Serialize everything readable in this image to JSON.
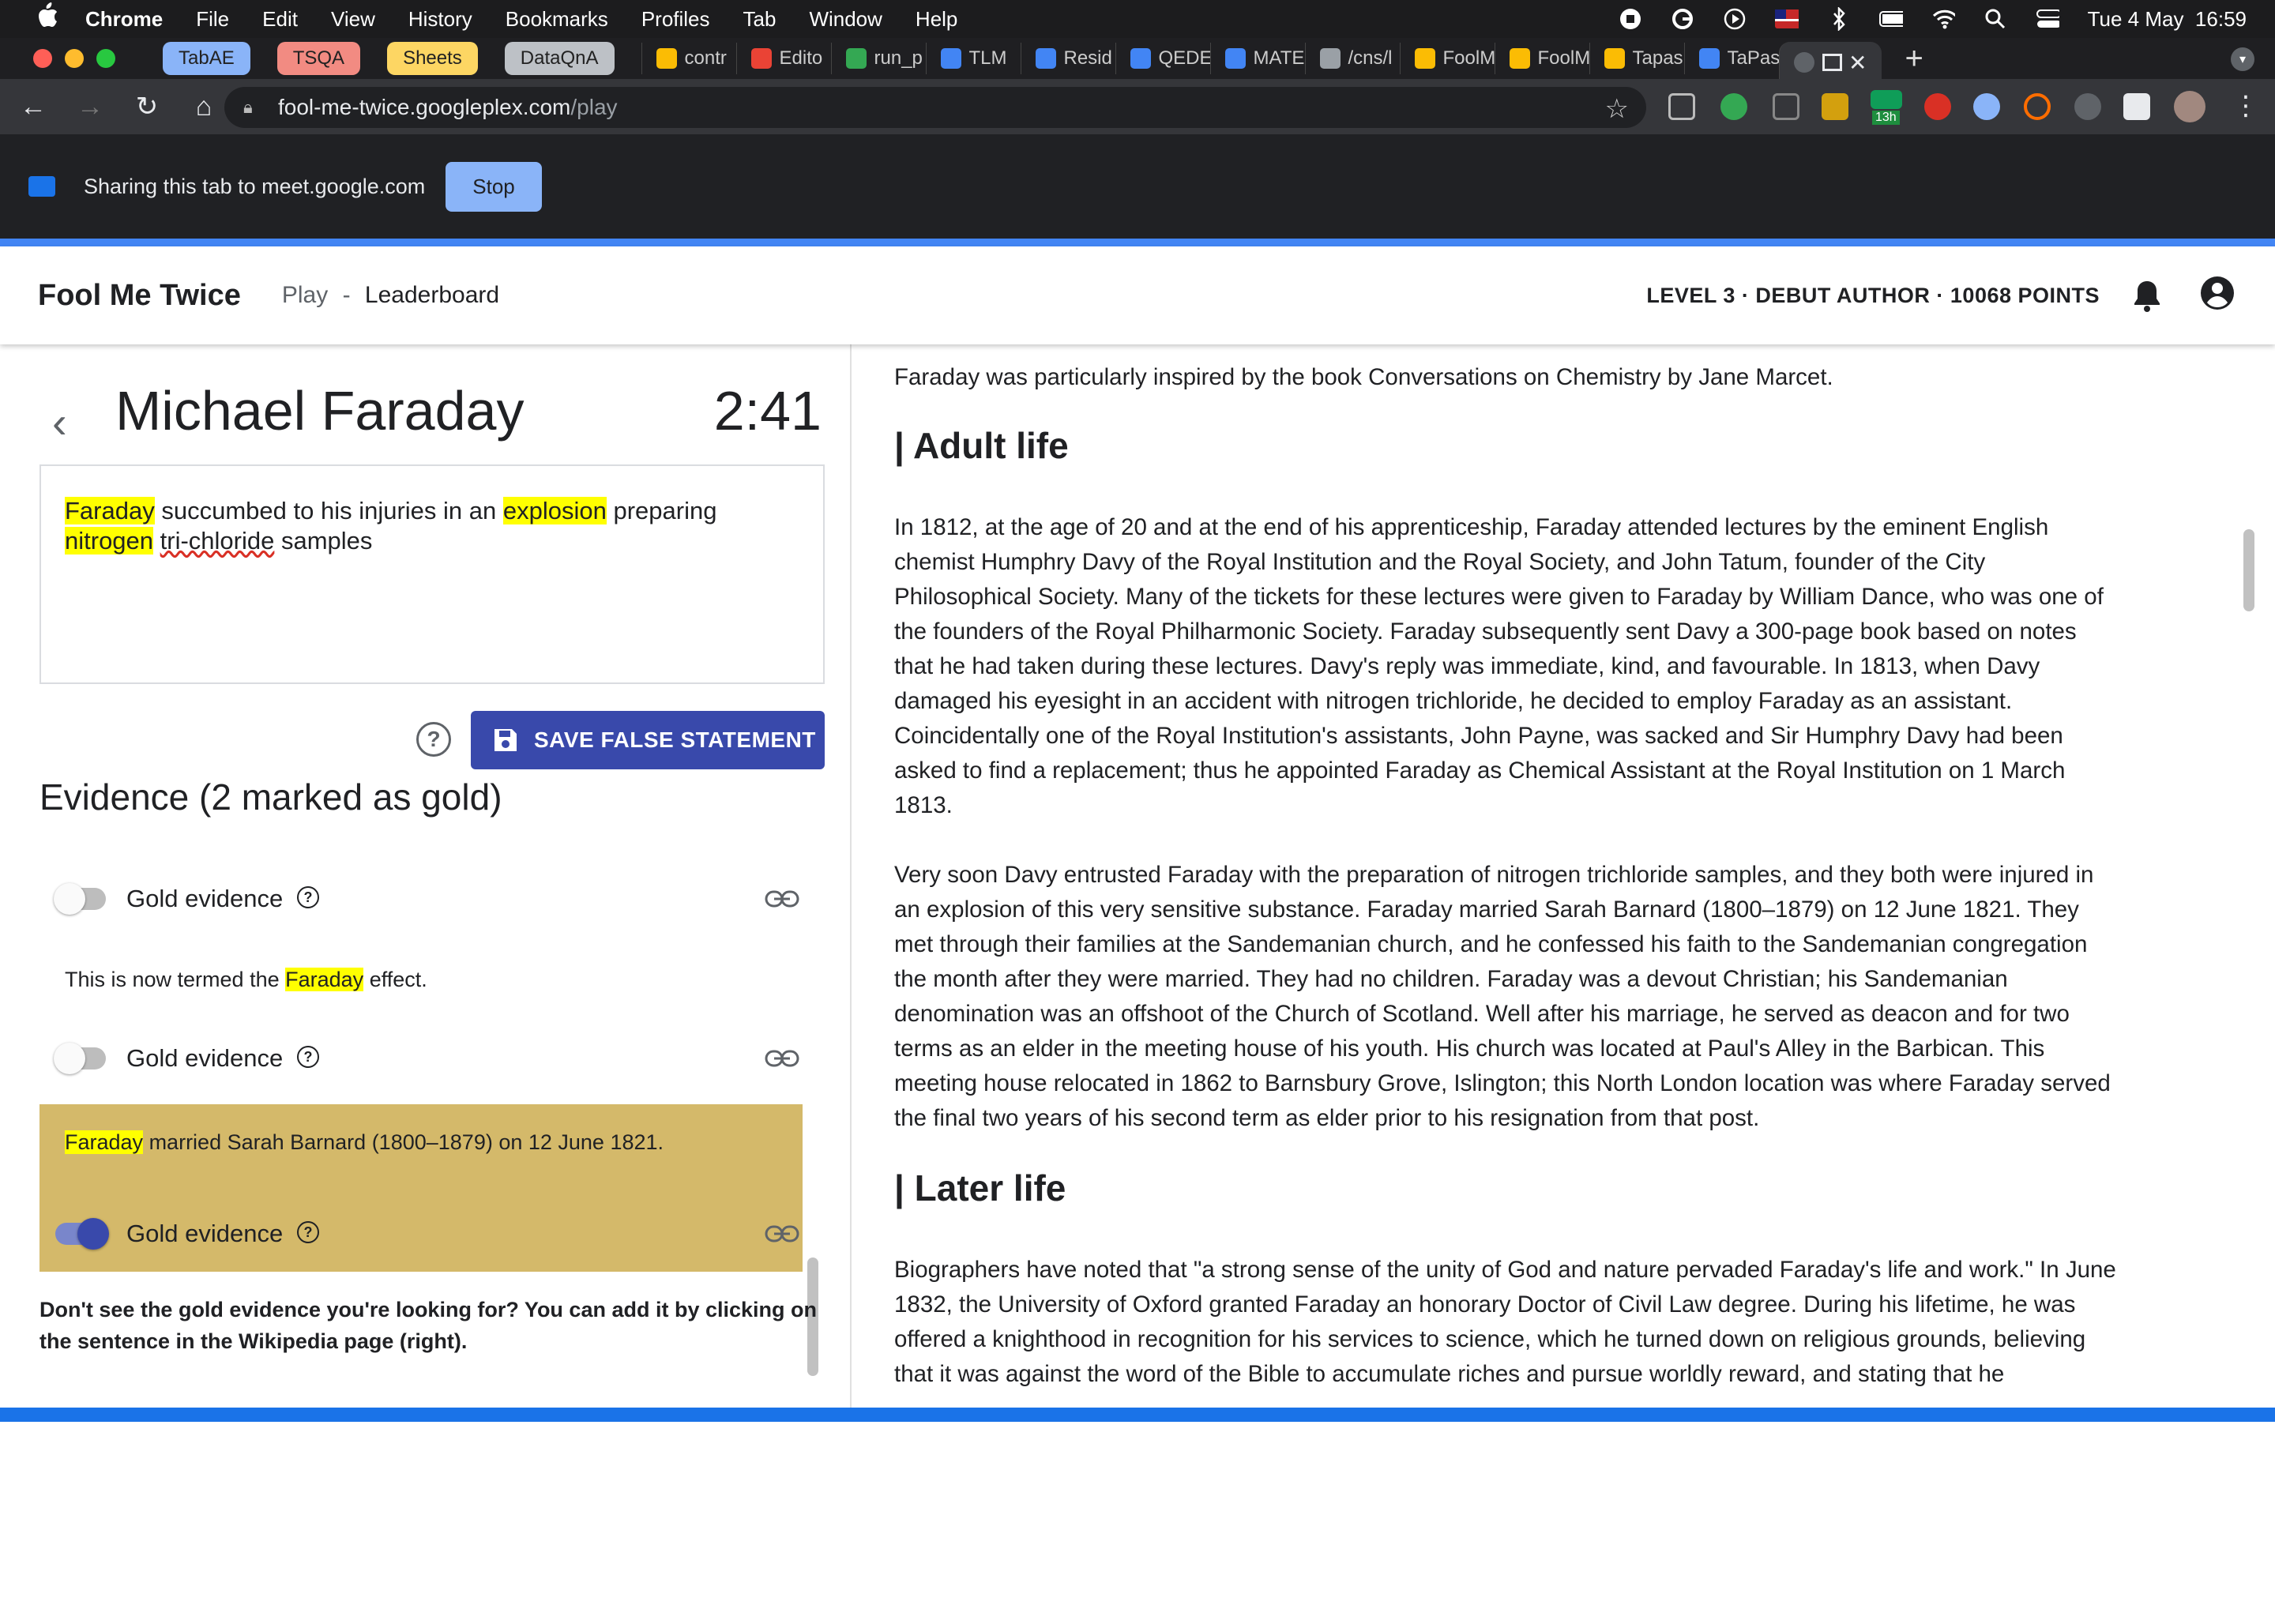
{
  "menubar": {
    "app": "Chrome",
    "items": [
      "File",
      "Edit",
      "View",
      "History",
      "Bookmarks",
      "Profiles",
      "Tab",
      "Window",
      "Help"
    ],
    "datetime": "Tue 4 May  16:59"
  },
  "tabs": {
    "groups": [
      {
        "label": "TabAE",
        "color": "#8ab4f8"
      },
      {
        "label": "TSQA",
        "color": "#f28b82"
      },
      {
        "label": "Sheets",
        "color": "#fdd663"
      },
      {
        "label": "DataQnA",
        "color": "#bdc1c6"
      }
    ],
    "items": [
      {
        "label": "contr",
        "color": "#fbbc04"
      },
      {
        "label": "Edito",
        "color": "#ea4335"
      },
      {
        "label": "run_p",
        "color": "#34a853"
      },
      {
        "label": "TLM",
        "color": "#4285f4"
      },
      {
        "label": "Resid",
        "color": "#4285f4"
      },
      {
        "label": "QEDE",
        "color": "#4285f4"
      },
      {
        "label": "MATE",
        "color": "#4285f4"
      },
      {
        "label": "/cns/l",
        "color": "#9aa0a6"
      },
      {
        "label": "FoolM",
        "color": "#fbbc04"
      },
      {
        "label": "FoolM",
        "color": "#fbbc04"
      },
      {
        "label": "Tapas",
        "color": "#fbbc04"
      },
      {
        "label": "TaPas",
        "color": "#4285f4"
      }
    ]
  },
  "toolbar": {
    "url_host": "fool-me-twice.googleplex.com",
    "url_path": "/play",
    "extension_badge": "13h"
  },
  "sharebar": {
    "text": "Sharing this tab to meet.google.com",
    "stop_label": "Stop"
  },
  "header": {
    "brand": "Fool Me Twice",
    "nav_play": "Play",
    "nav_sep": "-",
    "nav_leaderboard": "Leaderboard",
    "status": "LEVEL 3 · DEBUT AUTHOR · 10068 POINTS"
  },
  "left": {
    "title": "Michael Faraday",
    "timer": "2:41",
    "statement": {
      "w1": "Faraday",
      "w2": " succumbed to his injuries in an ",
      "w3": "explosion",
      "w4": " preparing ",
      "w5": "nitrogen",
      "w6": " ",
      "w7": "tri-chloride",
      "w8": " samples"
    },
    "help": "?",
    "save_label": "SAVE FALSE STATEMENT",
    "evidence_heading": "Evidence (2 marked as gold)",
    "gold_label": "Gold evidence",
    "evidence": [
      {
        "pre": "This is now termed the ",
        "hl": "Faraday",
        "post": " effect."
      },
      {
        "pre": "",
        "hl": "Faraday",
        "post": " married Sarah Barnard (1800–1879) on 12 June 1821."
      }
    ],
    "hint": "Don't see the gold evidence you're looking for? You can add it by clicking on the sentence in the Wikipedia page (right)."
  },
  "article": {
    "intro": "Faraday was particularly inspired by the book Conversations on Chemistry by Jane Marcet.",
    "h_adult": "| Adult life",
    "p1_lines": [
      "In 1812, at the age of 20 and at the end of his apprenticeship, Faraday attended lectures by the eminent English",
      "chemist Humphry Davy of the Royal Institution and the Royal Society, and John Tatum, founder of the City",
      "Philosophical Society. Many of the tickets for these lectures were given to Faraday by William Dance, who was one of",
      "the founders of the Royal Philharmonic Society. Faraday subsequently sent Davy a 300-page book based on notes",
      "that he had taken during these lectures. Davy's reply was immediate, kind, and favourable. In 1813, when Davy",
      "damaged his eyesight in an accident with nitrogen trichloride, he decided to employ Faraday as an assistant.",
      "Coincidentally one of the Royal Institution's assistants, John Payne, was sacked and Sir Humphry Davy had been",
      "asked to find a replacement; thus he appointed Faraday as Chemical Assistant at the Royal Institution on 1 March",
      "1813."
    ],
    "p2_lines": [
      "Very soon Davy entrusted Faraday with the preparation of nitrogen trichloride samples, and they both were injured in",
      "an explosion of this very sensitive substance. Faraday married Sarah Barnard (1800–1879) on 12 June 1821. They",
      "met through their families at the Sandemanian church, and he confessed his faith to the Sandemanian congregation",
      "the month after they were married. They had no children. Faraday was a devout Christian; his Sandemanian",
      "denomination was an offshoot of the Church of Scotland. Well after his marriage, he served as deacon and for two",
      "terms as an elder in the meeting house of his youth. His church was located at Paul's Alley in the Barbican. This",
      "meeting house relocated in 1862 to Barnsbury Grove, Islington; this North London location was where Faraday served",
      "the final two years of his second term as elder prior to his resignation from that post."
    ],
    "h_later": "| Later life",
    "p3_lines": [
      "Biographers have noted that \"a strong sense of the unity of God and nature pervaded Faraday's life and work.\" In June",
      "1832, the University of Oxford granted Faraday an honorary Doctor of Civil Law degree. During his lifetime, he was",
      "offered a knighthood in recognition for his services to science, which he turned down on religious grounds, believing",
      "that it was against the word of the Bible to accumulate riches and pursue worldly reward, and stating that he"
    ]
  },
  "icons": [
    "apple-icon",
    "back-arrow-icon",
    "bell-icon",
    "account-icon",
    "save-disk-icon",
    "help-icon",
    "link-icon",
    "lock-icon",
    "star-icon"
  ]
}
